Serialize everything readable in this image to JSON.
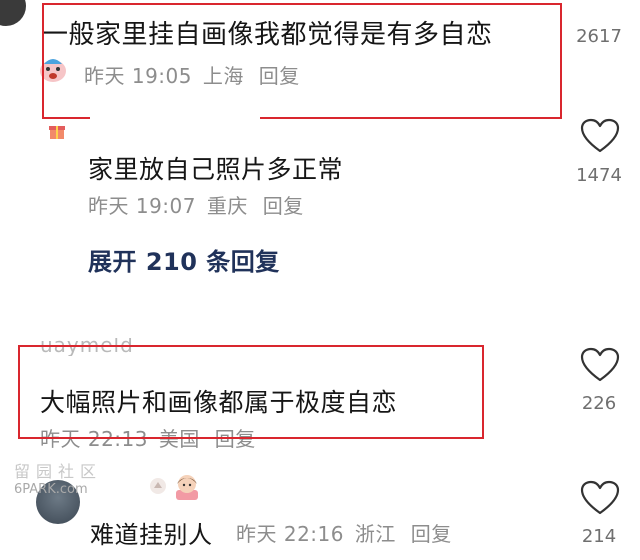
{
  "comments": [
    {
      "text": "一般家里挂自画像我都觉得是有多自恋",
      "time": "昨天 19:05",
      "location": "上海",
      "reply": "回复",
      "likes": "2617"
    },
    {
      "username_partial": "",
      "text": "家里放自己照片多正常",
      "time": "昨天 19:07",
      "location": "重庆",
      "reply": "回复",
      "likes": "1474"
    },
    {
      "username_partial": "uaymeld",
      "text": "大幅照片和画像都属于极度自恋",
      "time": "昨天 22:13",
      "location": "美国",
      "reply": "回复",
      "likes": "226"
    },
    {
      "username_partial": "",
      "text": "难道挂别人",
      "time": "昨天 22:16",
      "location": "浙江",
      "reply": "回复",
      "likes": "214"
    }
  ],
  "expand_replies": "展开 210 条回复",
  "watermark": {
    "cn": "留园社区",
    "en": "6PARK.com"
  },
  "colors": {
    "highlight_border": "#d9262e",
    "expand_text": "#20325a",
    "meta_text": "#8d8d8d"
  }
}
